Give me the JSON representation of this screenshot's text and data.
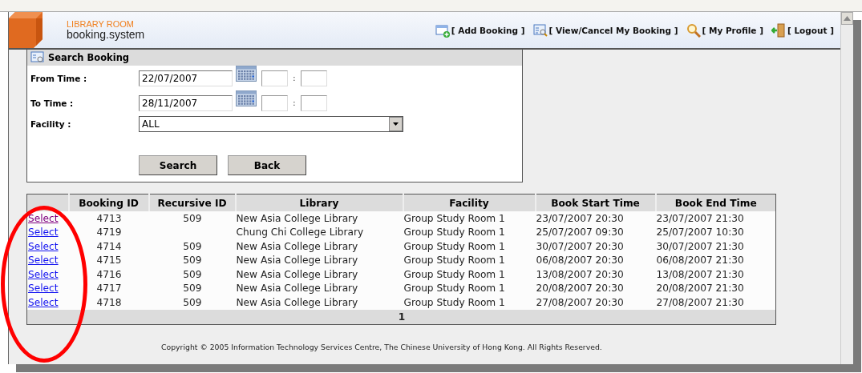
{
  "header": {
    "logo_top": "LIBRARY ROOM",
    "logo_bottom": "booking.system",
    "nav": [
      {
        "kind": "add",
        "label": "[ Add Booking ]"
      },
      {
        "kind": "view",
        "label": "[ View/Cancel My Booking ]"
      },
      {
        "kind": "profile",
        "label": "[ My Profile ]"
      },
      {
        "kind": "logout",
        "label": "[ Logout ]"
      }
    ]
  },
  "search_panel": {
    "title": "Search Booking",
    "from_label": "From Time :",
    "from_date": "22/07/2007",
    "to_label": "To Time :",
    "to_date": "28/11/2007",
    "time_separator": ":",
    "facility_label": "Facility :",
    "facility_value": "ALL",
    "buttons": [
      "Search",
      "Back"
    ]
  },
  "table": {
    "columns": [
      "Booking ID",
      "Recursive ID",
      "Library",
      "Facility",
      "Book Start Time",
      "Book End Time"
    ],
    "rows": [
      {
        "link": "Select",
        "visited": true,
        "booking_id": "4713",
        "recursive_id": "509",
        "library": "New Asia College Library",
        "facility": "Group Study Room 1",
        "start": "23/07/2007 20:30",
        "end": "23/07/2007 21:30"
      },
      {
        "link": "Select",
        "visited": false,
        "booking_id": "4719",
        "library": "Chung Chi College Library",
        "facility": "Group Study Room 1",
        "start": "25/07/2007 09:30",
        "end": "25/07/2007 10:30"
      },
      {
        "link": "Select",
        "visited": false,
        "booking_id": "4714",
        "recursive_id": "509",
        "library": "New Asia College Library",
        "facility": "Group Study Room 1",
        "start": "30/07/2007 20:30",
        "end": "30/07/2007 21:30"
      },
      {
        "link": "Select",
        "visited": false,
        "booking_id": "4715",
        "recursive_id": "509",
        "library": "New Asia College Library",
        "facility": "Group Study Room 1",
        "start": "06/08/2007 20:30",
        "end": "06/08/2007 21:30"
      },
      {
        "link": "Select",
        "visited": false,
        "booking_id": "4716",
        "recursive_id": "509",
        "library": "New Asia College Library",
        "facility": "Group Study Room 1",
        "start": "13/08/2007 20:30",
        "end": "13/08/2007 21:30"
      },
      {
        "link": "Select",
        "visited": false,
        "booking_id": "4717",
        "recursive_id": "509",
        "library": "New Asia College Library",
        "facility": "Group Study Room 1",
        "start": "20/08/2007 20:30",
        "end": "20/08/2007 21:30"
      },
      {
        "link": "Select",
        "visited": false,
        "booking_id": "4718",
        "recursive_id": "509",
        "library": "New Asia College Library",
        "facility": "Group Study Room 1",
        "start": "27/08/2007 20:30",
        "end": "27/08/2007 21:30"
      }
    ],
    "pager": "1"
  },
  "footer": "Copyright © 2005 Information Technology Services Centre, The Chinese University of Hong Kong. All Rights Reserved."
}
